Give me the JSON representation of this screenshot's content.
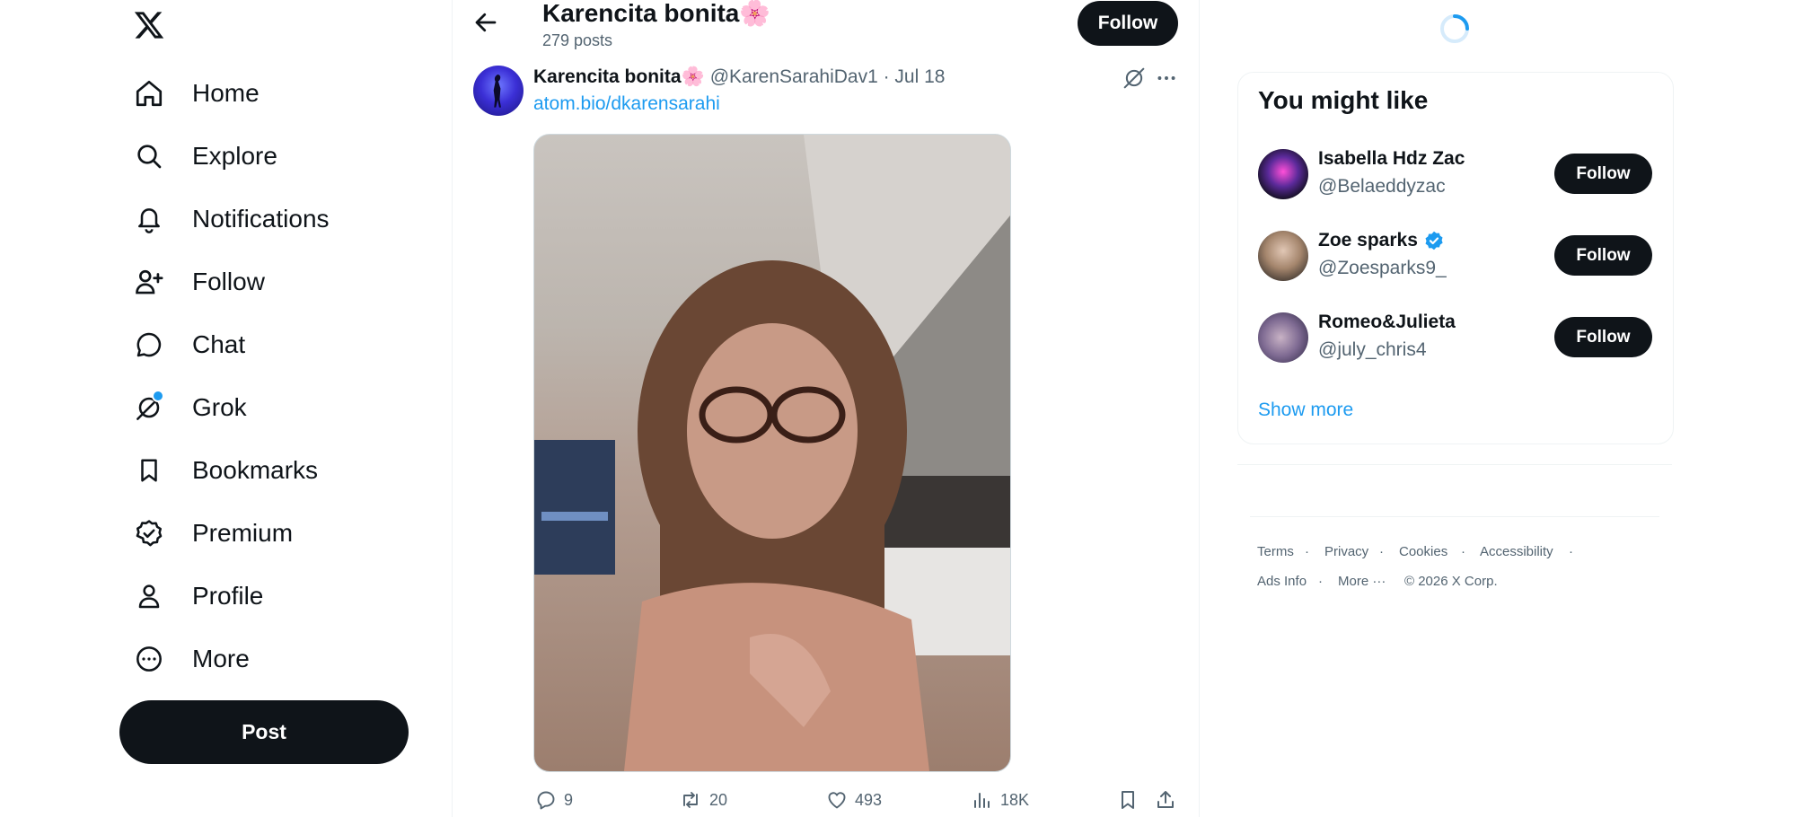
{
  "colors": {
    "accent": "#1d9bf0",
    "text": "#0f1419",
    "muted": "#536471",
    "button": "#0f1419",
    "verified": "#1d9bf0"
  },
  "nav": {
    "logo_icon": "x-logo-icon",
    "items": [
      {
        "label": "Home",
        "icon": "home-icon"
      },
      {
        "label": "Explore",
        "icon": "search-icon"
      },
      {
        "label": "Notifications",
        "icon": "bell-icon"
      },
      {
        "label": "Follow",
        "icon": "person-add-icon"
      },
      {
        "label": "Chat",
        "icon": "chat-bubble-icon"
      },
      {
        "label": "Grok",
        "icon": "grok-icon"
      },
      {
        "label": "Bookmarks",
        "icon": "bookmark-icon"
      },
      {
        "label": "Premium",
        "icon": "verified-badge-icon"
      },
      {
        "label": "Profile",
        "icon": "person-icon"
      },
      {
        "label": "More",
        "icon": "more-circle-icon"
      }
    ],
    "post_label": "Post"
  },
  "header": {
    "name": "Karencita bonita🌸",
    "posts_count": "279 posts",
    "follow_label": "Follow"
  },
  "tweet": {
    "display_name": "Karencita bonita🌸",
    "meta": "@KarenSarahiDav1 · Jul 18",
    "link": "atom.bio/dkarensarahi",
    "replies": "9",
    "reposts": "20",
    "likes": "493",
    "views": "18K"
  },
  "sidebar": {
    "title": "You might like",
    "suggestions": [
      {
        "name": "Isabella Hdz Zac",
        "handle": "@Belaeddyzac",
        "follow_label": "Follow",
        "verified": false
      },
      {
        "name": "Zoe sparks",
        "handle": "@Zoesparks9_",
        "follow_label": "Follow",
        "verified": true
      },
      {
        "name": "Romeo&Julieta",
        "handle": "@july_chris4",
        "follow_label": "Follow",
        "verified": false
      }
    ],
    "show_more": "Show more"
  },
  "footer": {
    "terms": "Terms",
    "privacy": "Privacy",
    "cookies": "Cookies",
    "accessibility": "Accessibility",
    "ads_info": "Ads Info",
    "more": "More ···",
    "copyright": "© 2026 X Corp."
  }
}
